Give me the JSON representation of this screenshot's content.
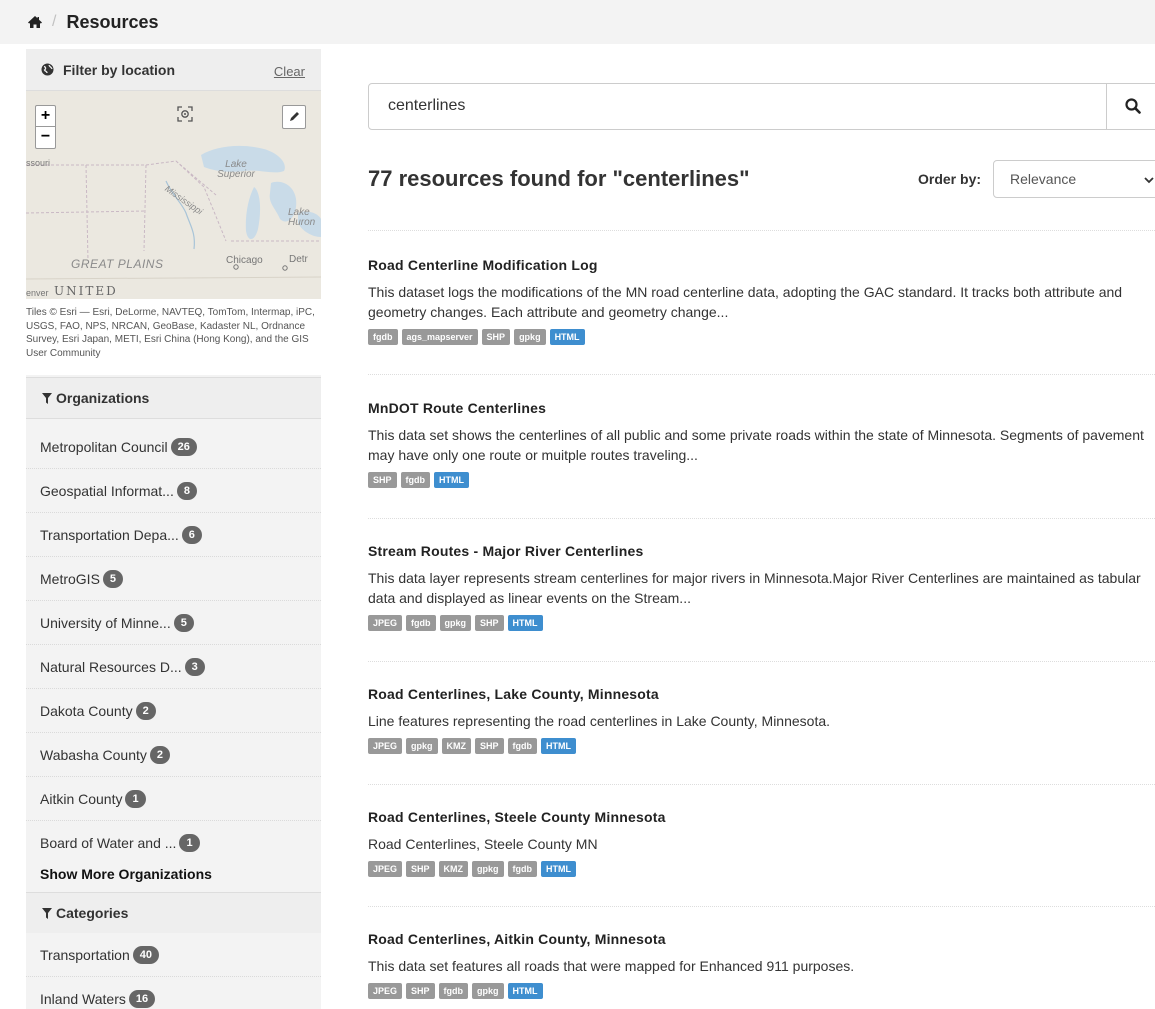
{
  "breadcrumb": {
    "current": "Resources"
  },
  "location_filter": {
    "title": "Filter by location",
    "clear_label": "Clear",
    "map_labels": [
      "Lake Superior",
      "Lake Huron",
      "Mississippi",
      "GREAT PLAINS",
      "Chicago",
      "Detr",
      "UNITED",
      "enver",
      "ssouri"
    ],
    "attribution": "Tiles © Esri — Esri, DeLorme, NAVTEQ, TomTom, Intermap, iPC, USGS, FAO, NPS, NRCAN, GeoBase, Kadaster NL, Ordnance Survey, Esri Japan, METI, Esri China (Hong Kong), and the GIS User Community"
  },
  "organizations": {
    "title": "Organizations",
    "items": [
      {
        "label": "Metropolitan Council",
        "count": "26"
      },
      {
        "label": "Geospatial Informat...",
        "count": "8"
      },
      {
        "label": "Transportation Depa...",
        "count": "6"
      },
      {
        "label": "MetroGIS",
        "count": "5"
      },
      {
        "label": "University of Minne...",
        "count": "5"
      },
      {
        "label": "Natural Resources D...",
        "count": "3"
      },
      {
        "label": "Dakota County",
        "count": "2"
      },
      {
        "label": "Wabasha County",
        "count": "2"
      },
      {
        "label": "Aitkin County",
        "count": "1"
      },
      {
        "label": "Board of Water and ...",
        "count": "1"
      }
    ],
    "show_more": "Show More Organizations"
  },
  "categories": {
    "title": "Categories",
    "items": [
      {
        "label": "Transportation",
        "count": "40"
      },
      {
        "label": "Inland Waters",
        "count": "16"
      }
    ]
  },
  "search": {
    "value": "centerlines"
  },
  "results_header": "77 resources found for \"centerlines\"",
  "order_by": {
    "label": "Order by:",
    "selected": "Relevance"
  },
  "results": [
    {
      "title": "Road Centerline Modification Log",
      "description": "This dataset logs the modifications of the MN road centerline data, adopting the GAC standard. It tracks both attribute and geometry changes. Each attribute and geometry change...",
      "formats": [
        "fgdb",
        "ags_mapserver",
        "SHP",
        "gpkg",
        "HTML"
      ]
    },
    {
      "title": "MnDOT Route Centerlines",
      "description": "This data set shows the centerlines of all public and some private roads within the state of Minnesota. Segments of pavement may have only one route or muitple routes traveling...",
      "formats": [
        "SHP",
        "fgdb",
        "HTML"
      ]
    },
    {
      "title": "Stream Routes - Major River Centerlines",
      "description": "This data layer represents stream centerlines for major rivers in Minnesota.Major River Centerlines are maintained as tabular data and displayed as linear events on the Stream...",
      "formats": [
        "JPEG",
        "fgdb",
        "gpkg",
        "SHP",
        "HTML"
      ]
    },
    {
      "title": "Road Centerlines, Lake County, Minnesota",
      "description": "Line features representing the road centerlines in Lake County, Minnesota.",
      "formats": [
        "JPEG",
        "gpkg",
        "KMZ",
        "SHP",
        "fgdb",
        "HTML"
      ]
    },
    {
      "title": "Road Centerlines, Steele County Minnesota",
      "description": "Road Centerlines, Steele County MN",
      "formats": [
        "JPEG",
        "SHP",
        "KMZ",
        "gpkg",
        "fgdb",
        "HTML"
      ]
    },
    {
      "title": "Road Centerlines, Aitkin County, Minnesota",
      "description": "This data set features all roads that were mapped for Enhanced 911 purposes.",
      "formats": [
        "JPEG",
        "SHP",
        "fgdb",
        "gpkg",
        "HTML"
      ]
    }
  ],
  "colors": {
    "html_tag": "#3e8ecf",
    "format_tag": "#999999",
    "badge": "#666666",
    "sidebar_bg": "#f3f3f3"
  }
}
